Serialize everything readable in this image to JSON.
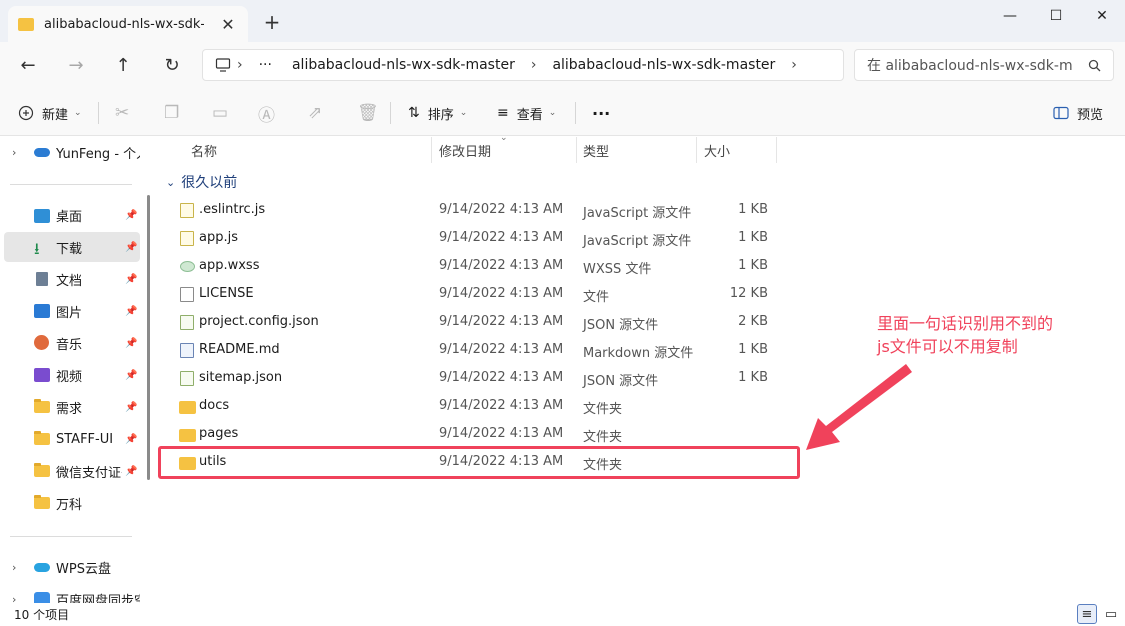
{
  "window": {
    "tab_title": "alibabacloud-nls-wx-sdk-master",
    "tab_close": "✕",
    "new_tab": "+",
    "minimize": "—",
    "maximize": "☐",
    "close": "✕"
  },
  "nav": {
    "back": "←",
    "forward": "→",
    "up": "↑",
    "refresh": "↻",
    "breadcrumb": [
      "alibabacloud-nls-wx-sdk-master",
      "alibabacloud-nls-wx-sdk-master"
    ],
    "overflow": "···",
    "search_placeholder": "在 alibabacloud-nls-wx-sdk-master 中搜索"
  },
  "toolbar": {
    "new_label": "新建",
    "sort_label": "排序",
    "view_label": "查看",
    "more": "···",
    "preview_label": "预览"
  },
  "sidebar": {
    "cloud": "YunFeng - 个人",
    "items": [
      {
        "label": "桌面",
        "icon": "desktop-icon",
        "pinned": true
      },
      {
        "label": "下载",
        "icon": "download-icon",
        "pinned": true,
        "selected": true
      },
      {
        "label": "文档",
        "icon": "document-icon",
        "pinned": true
      },
      {
        "label": "图片",
        "icon": "picture-icon",
        "pinned": true
      },
      {
        "label": "音乐",
        "icon": "music-icon",
        "pinned": true
      },
      {
        "label": "视频",
        "icon": "video-icon",
        "pinned": true
      },
      {
        "label": "需求",
        "icon": "folder-icon",
        "pinned": true
      },
      {
        "label": "STAFF-UI",
        "icon": "folder-icon",
        "pinned": true
      },
      {
        "label": "微信支付证书",
        "icon": "folder-icon",
        "pinned": true
      },
      {
        "label": "万科",
        "icon": "folder-icon",
        "pinned": false
      }
    ],
    "wps": "WPS云盘",
    "baidu": "百度网盘同步空间"
  },
  "columns": {
    "name": "名称",
    "date": "修改日期",
    "type": "类型",
    "size": "大小"
  },
  "group_label": "很久以前",
  "files": [
    {
      "name": ".eslintrc.js",
      "date": "9/14/2022 4:13 AM",
      "type": "JavaScript 源文件",
      "size": "1 KB",
      "icon": "js-file-icon"
    },
    {
      "name": "app.js",
      "date": "9/14/2022 4:13 AM",
      "type": "JavaScript 源文件",
      "size": "1 KB",
      "icon": "js-file-icon"
    },
    {
      "name": "app.wxss",
      "date": "9/14/2022 4:13 AM",
      "type": "WXSS 文件",
      "size": "1 KB",
      "icon": "wxss-file-icon"
    },
    {
      "name": "LICENSE",
      "date": "9/14/2022 4:13 AM",
      "type": "文件",
      "size": "12 KB",
      "icon": "blank-file-icon"
    },
    {
      "name": "project.config.json",
      "date": "9/14/2022 4:13 AM",
      "type": "JSON 源文件",
      "size": "2 KB",
      "icon": "json-file-icon"
    },
    {
      "name": "README.md",
      "date": "9/14/2022 4:13 AM",
      "type": "Markdown 源文件",
      "size": "1 KB",
      "icon": "markdown-file-icon"
    },
    {
      "name": "sitemap.json",
      "date": "9/14/2022 4:13 AM",
      "type": "JSON 源文件",
      "size": "1 KB",
      "icon": "json-file-icon"
    },
    {
      "name": "docs",
      "date": "9/14/2022 4:13 AM",
      "type": "文件夹",
      "size": "",
      "icon": "folder-icon"
    },
    {
      "name": "pages",
      "date": "9/14/2022 4:13 AM",
      "type": "文件夹",
      "size": "",
      "icon": "folder-icon"
    },
    {
      "name": "utils",
      "date": "9/14/2022 4:13 AM",
      "type": "文件夹",
      "size": "",
      "icon": "folder-icon"
    }
  ],
  "annotation": {
    "line1": "里面一句话识别用不到的",
    "line2": "js文件可以不用复制",
    "color": "#f0425b"
  },
  "status": {
    "count": "10 个项目"
  }
}
